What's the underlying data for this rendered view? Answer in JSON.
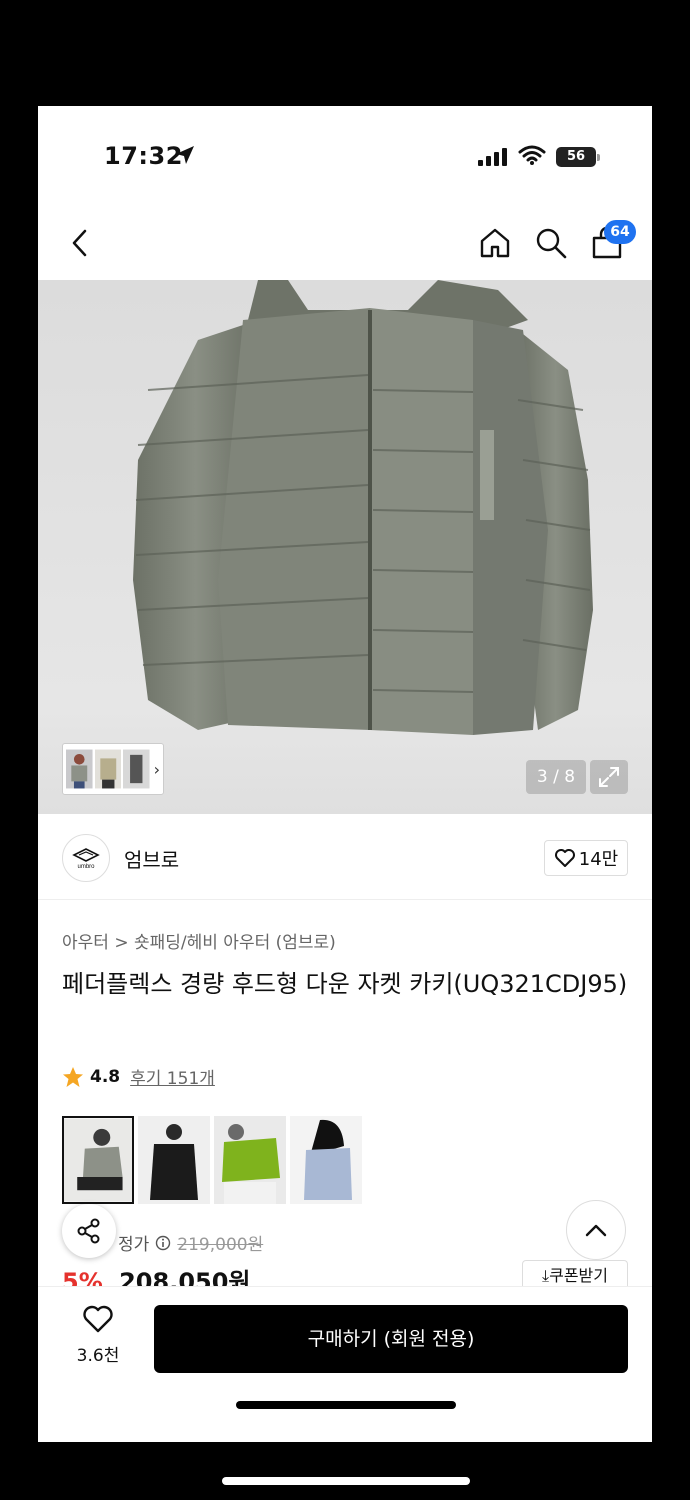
{
  "status_bar": {
    "time": "17:32",
    "battery": "56"
  },
  "nav": {
    "cart_count": "64"
  },
  "gallery": {
    "page_indicator": "3 / 8",
    "thumbs_more": "›"
  },
  "brand": {
    "name": "엄브로",
    "logo_text": "umbro",
    "likes": "14만"
  },
  "product": {
    "breadcrumb": "아우터 > 숏패딩/헤비 아우터 (엄브로)",
    "title": "페더플렉스 경량 후드형 다운 자켓 카키(UQ321CDJ95)",
    "rating": "4.8",
    "reviews": "후기 151개",
    "price_label": "정가",
    "original_price": "219,000원",
    "discount": "5%",
    "price": "208,050원",
    "coupon_label": "쿠폰받기"
  },
  "bottom_bar": {
    "wish_count": "3.6천",
    "buy_label": "구매하기 (회원 전용)"
  },
  "icons": {
    "back": "chevron-left-icon",
    "home": "home-icon",
    "search": "search-icon",
    "cart": "cart-icon",
    "expand": "expand-icon",
    "heart": "heart-icon",
    "star": "star-icon",
    "share": "share-icon",
    "to_top": "chevron-up-icon",
    "download": "download-icon"
  },
  "colors": {
    "accent_blue": "#1f72f0",
    "discount_red": "#e5322d",
    "star": "#f5a623",
    "jacket": "#7d8276"
  }
}
